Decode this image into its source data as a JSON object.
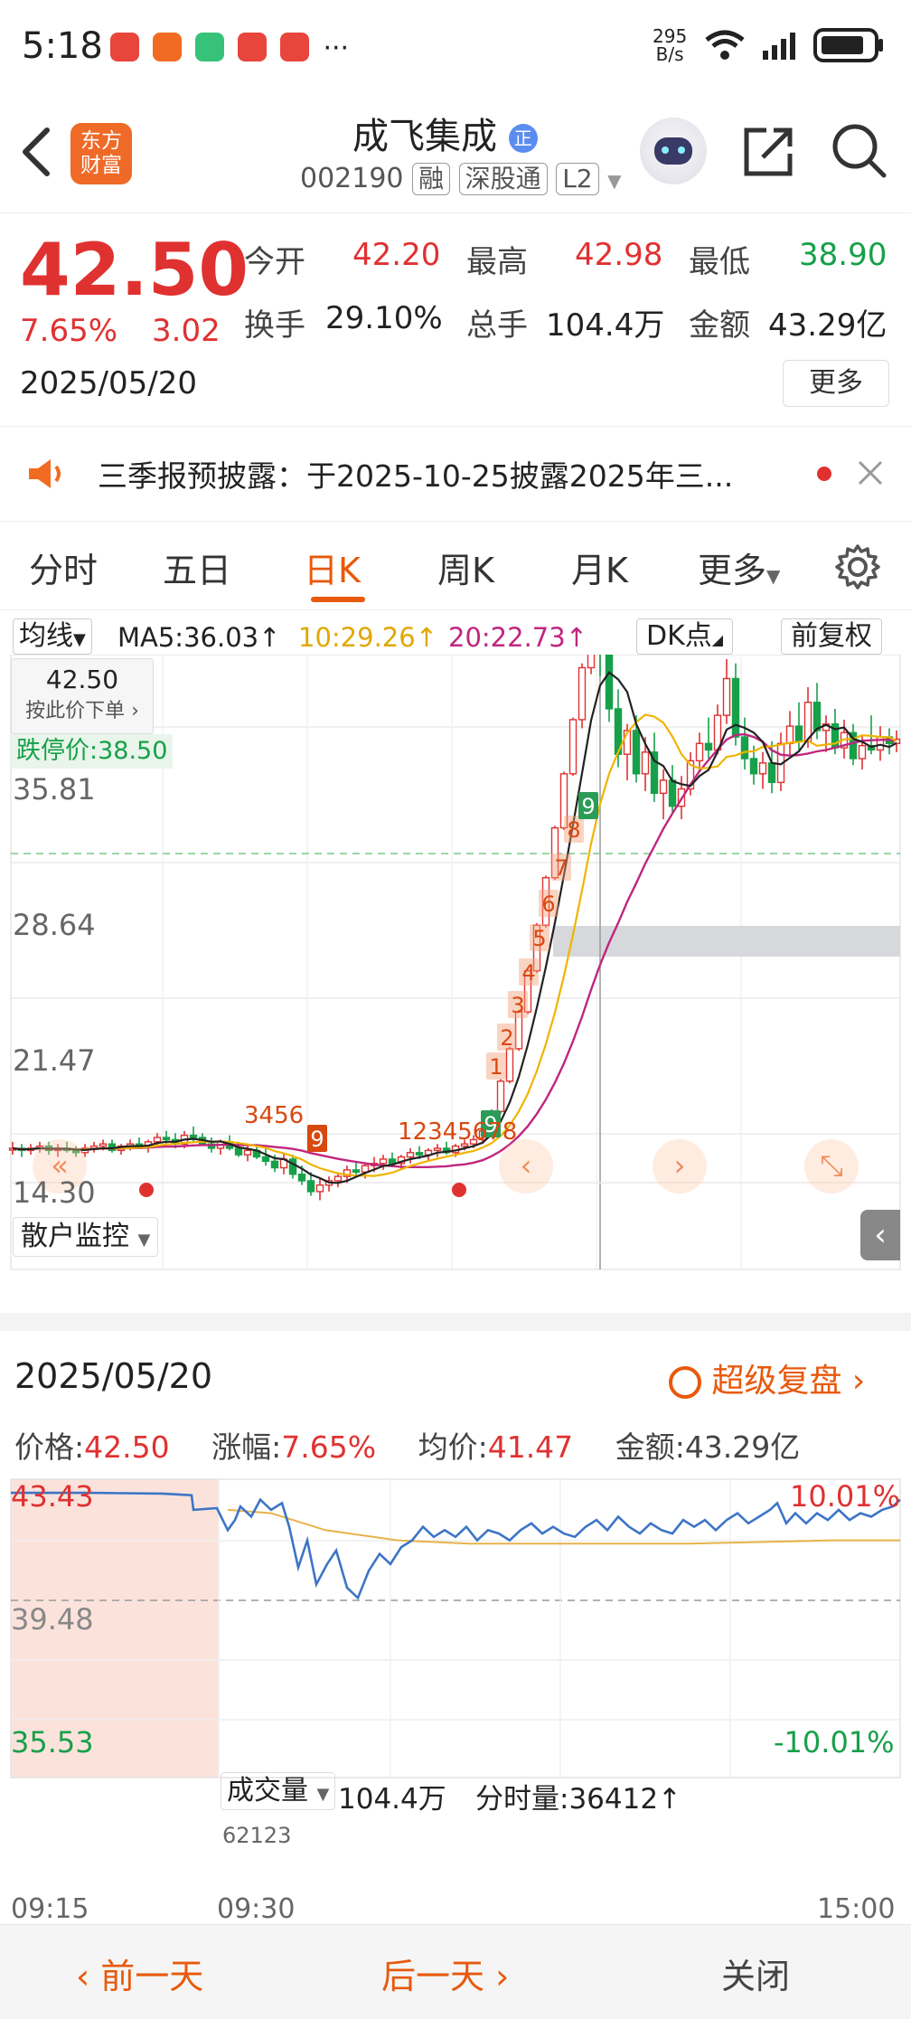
{
  "status_bar": {
    "time": "5:18",
    "net_speed_top": "295",
    "net_speed_unit": "B/s",
    "dots": "···"
  },
  "header": {
    "logo_line1": "东方",
    "logo_line2": "财富",
    "stock_name": "成飞集成",
    "badge": "正",
    "stock_code": "002190",
    "tag_margin": "融",
    "tag_connect": "深股通",
    "tag_level": "L2"
  },
  "quote": {
    "price": "42.50",
    "change_pct": "7.65%",
    "change_amt": "3.02",
    "date": "2025/05/20",
    "open_label": "今开",
    "open": "42.20",
    "high_label": "最高",
    "high": "42.98",
    "low_label": "最低",
    "low": "38.90",
    "turnover_label": "换手",
    "turnover": "29.10%",
    "volume_label": "总手",
    "volume": "104.4万",
    "amount_label": "金额",
    "amount": "43.29亿",
    "more_label": "更多"
  },
  "notice": {
    "text": "三季报预披露：于2025-10-25披露2025年三..."
  },
  "tabs": [
    {
      "label": "分时"
    },
    {
      "label": "五日"
    },
    {
      "label": "日K"
    },
    {
      "label": "周K"
    },
    {
      "label": "月K"
    },
    {
      "label": "更多"
    }
  ],
  "kchart": {
    "ma_dropdown": "均线",
    "ma5": "MA5:36.03↑",
    "ma10": "10:29.26↑",
    "ma20": "20:22.73↑",
    "dk_label": "DK点",
    "fq_label": "前复权",
    "popup_price": "42.50",
    "popup_action": "按此价下单",
    "limit_down_label": "跌停价:38.50",
    "y_labels": [
      "35.81",
      "28.64",
      "21.47",
      "14.30"
    ],
    "sub_indicator": "散户监控",
    "td_seq_a": "3456",
    "td_seq_b": "12345678",
    "nine_labels": [
      "9",
      "9",
      "9"
    ],
    "up_labels": [
      "1",
      "2",
      "3",
      "4",
      "5",
      "6",
      "7",
      "8"
    ],
    "colors": {
      "up": "#e03131",
      "down": "#17a04a",
      "ma5": "#222222",
      "ma10": "#f0b400",
      "ma20": "#c0267f"
    }
  },
  "detail": {
    "date": "2025/05/20",
    "replay_label": "超级复盘",
    "price_label": "价格:",
    "price": "42.50",
    "chg_label": "涨幅:",
    "chg": "7.65%",
    "avg_label": "均价:",
    "avg": "41.47",
    "amt_label": "金额:",
    "amt": "43.29亿",
    "y_top": "43.43",
    "y_mid": "39.48",
    "y_bot": "35.53",
    "pct_top": "10.01%",
    "pct_bot": "-10.01%",
    "vol_dropdown": "成交量",
    "vol_total": "104.4万",
    "tick_label": "分时量:36412↑",
    "vol_peak": "62123",
    "t_start": "09:15",
    "t_open": "09:30",
    "t_end": "15:00"
  },
  "bottom": {
    "prev": "前一天",
    "next": "后一天",
    "close": "关闭"
  }
}
